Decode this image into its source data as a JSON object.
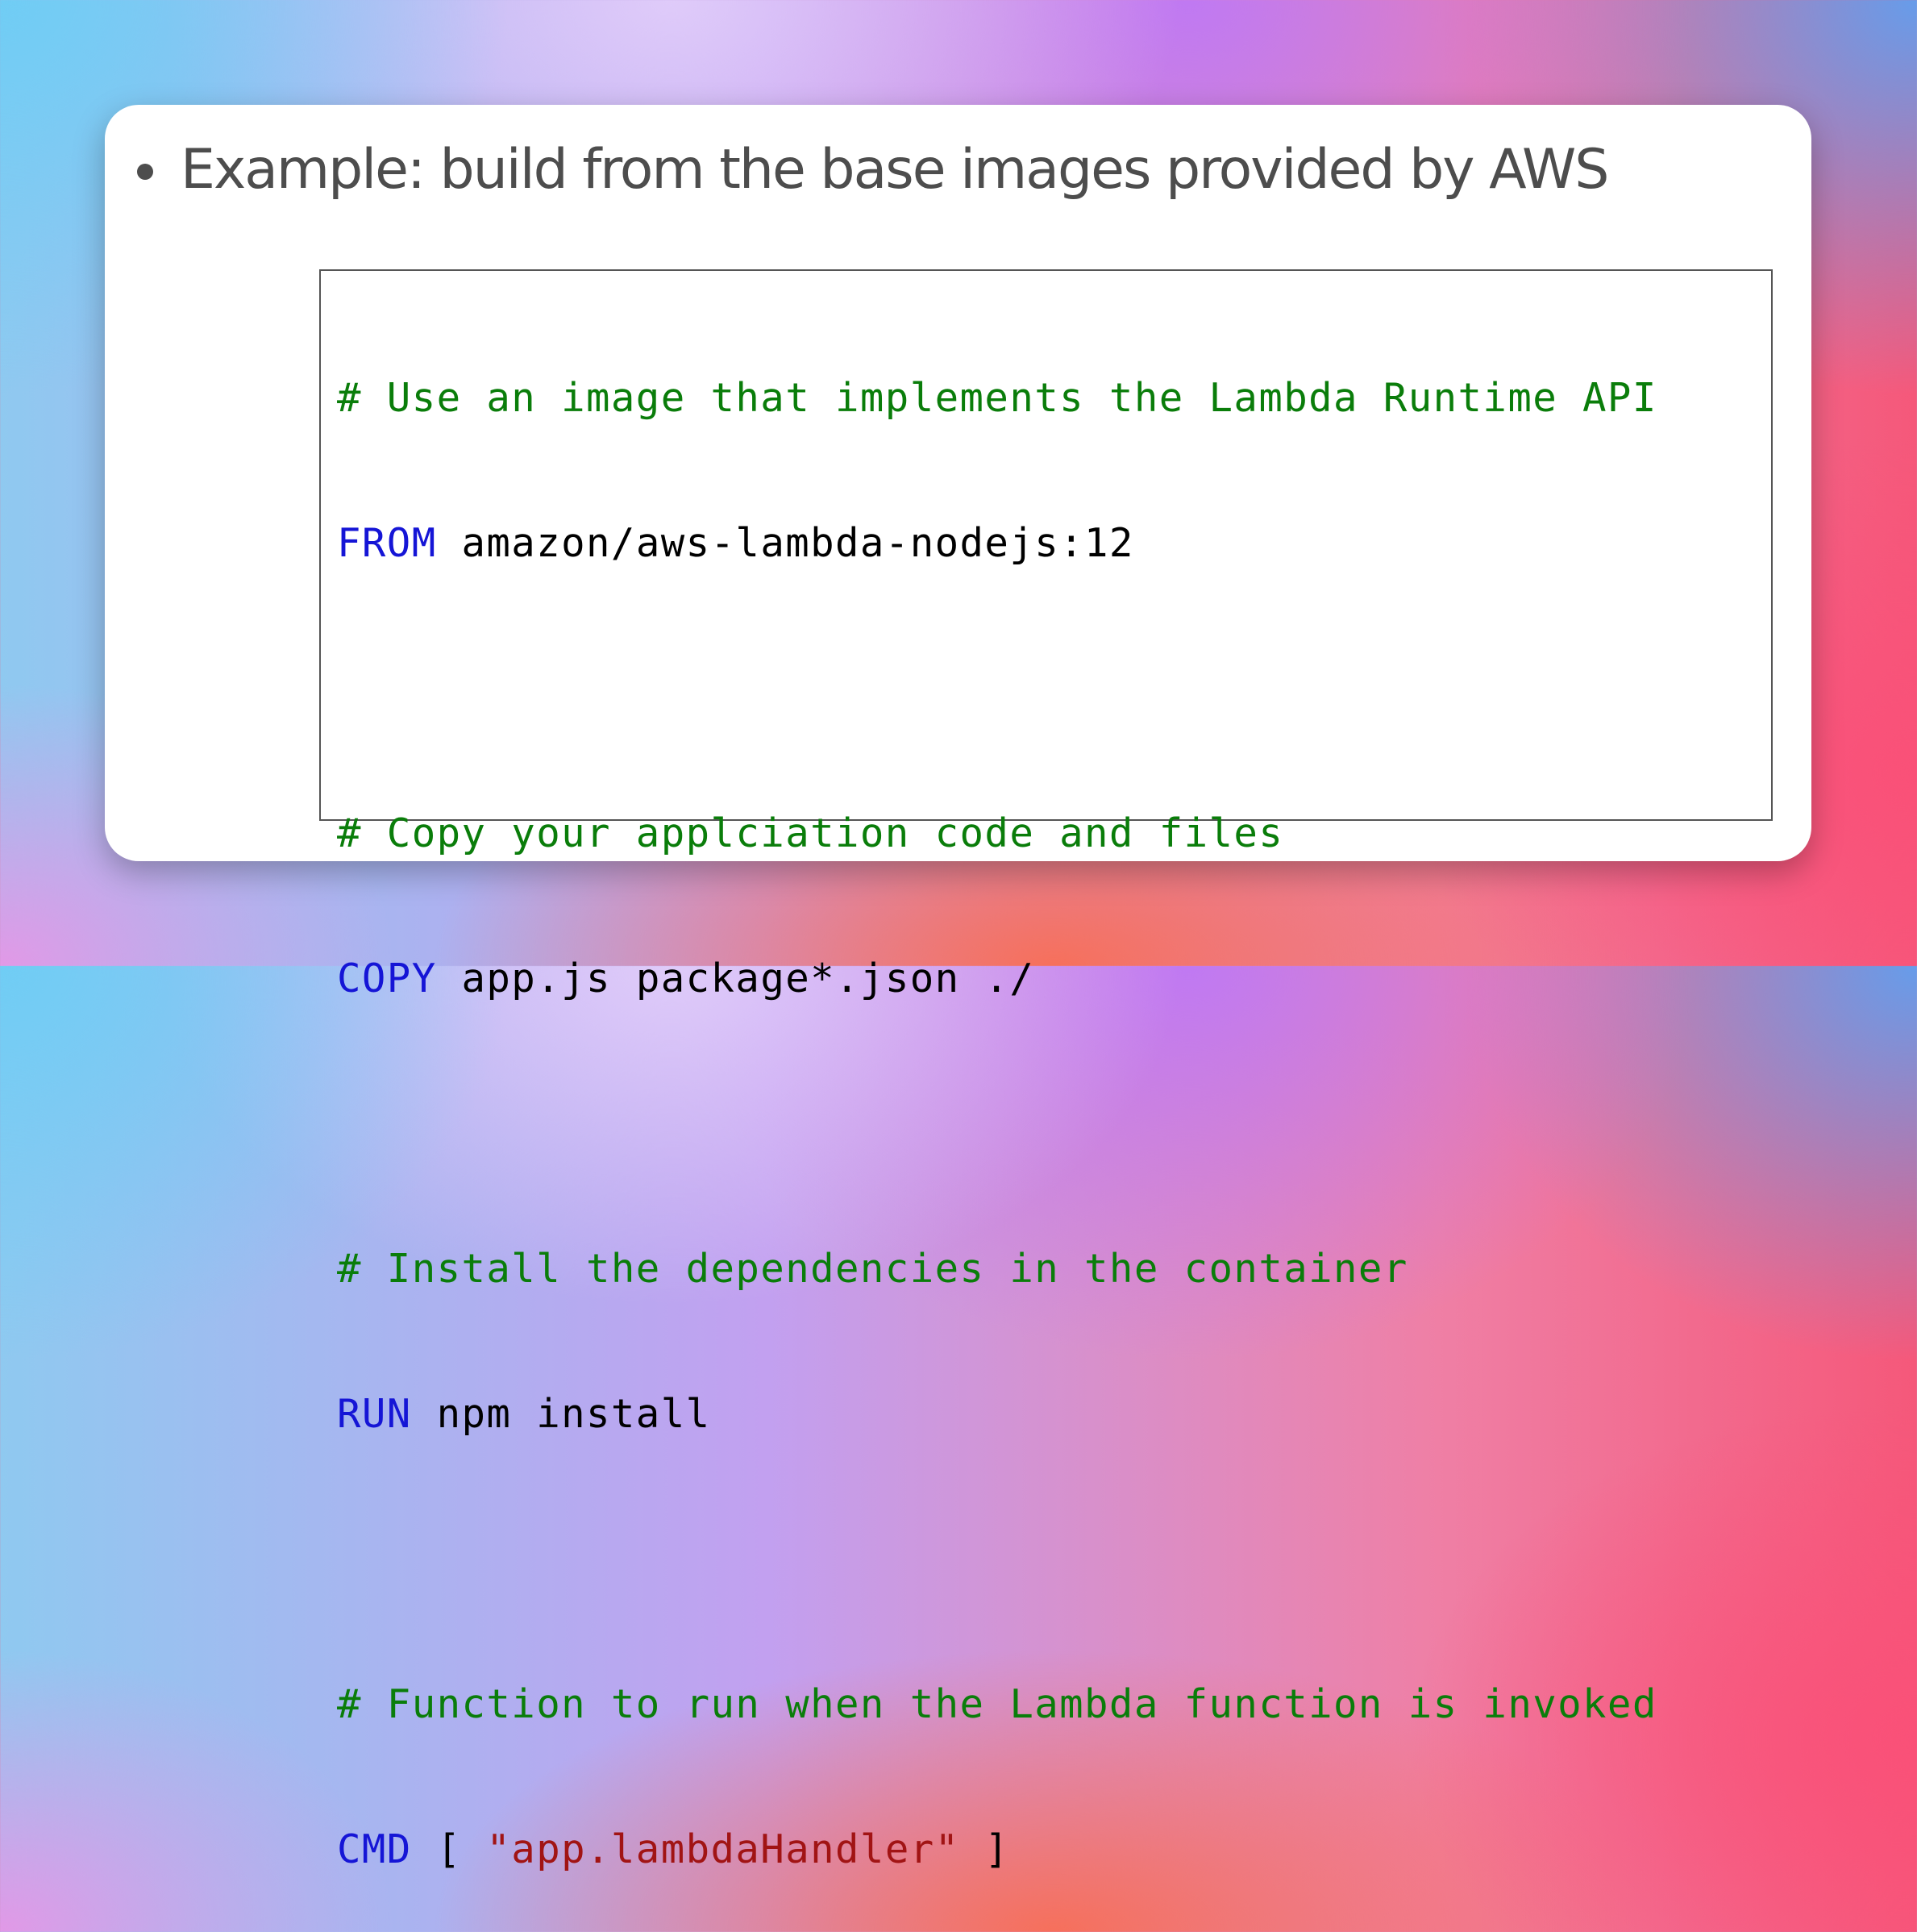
{
  "slide": {
    "bullet_text": "Example: build from the base images provided by AWS"
  },
  "code": {
    "line1_comment": "# Use an image that implements the Lambda Runtime API",
    "line2_keyword": "FROM",
    "line2_rest": " amazon/aws-lambda-nodejs:12",
    "line3_comment": "# Copy your applciation code and files",
    "line4_keyword": "COPY",
    "line4_rest": " app.js package*.json ./",
    "line5_comment": "# Install the dependencies in the container",
    "line6_keyword": "RUN",
    "line6_rest": " npm install",
    "line7_comment": "# Function to run when the Lambda function is invoked",
    "line8_keyword": "CMD",
    "line8_open": " [ ",
    "line8_string": "\"app.lambdaHandler\"",
    "line8_close": " ]"
  },
  "colors": {
    "comment": "#0a7d0a",
    "keyword": "#1515d6",
    "string": "#a11414",
    "text": "#000000"
  }
}
